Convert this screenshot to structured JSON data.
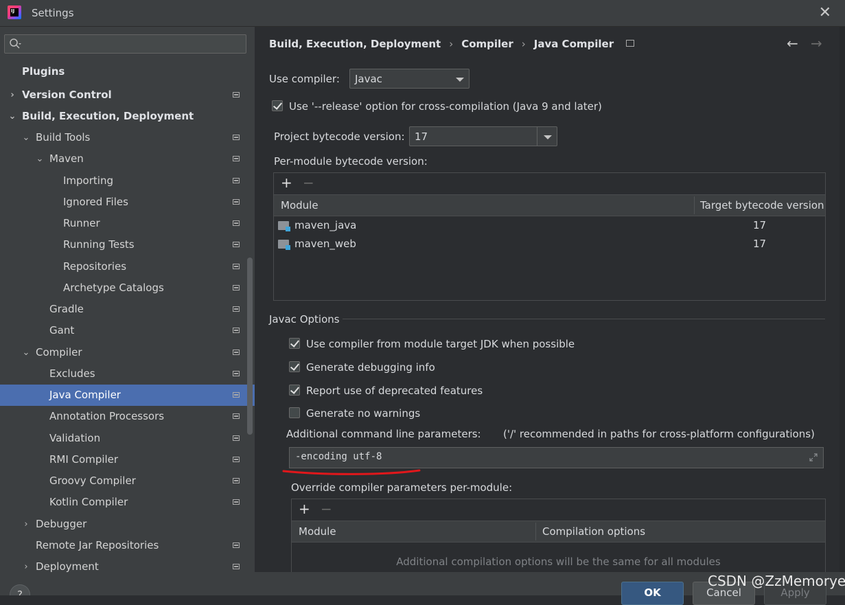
{
  "window": {
    "title": "Settings",
    "close_icon": "close-icon"
  },
  "sidebar": {
    "search_placeholder": "",
    "items": [
      {
        "label": "Plugins"
      },
      {
        "label": "Version Control"
      },
      {
        "label": "Build, Execution, Deployment"
      },
      {
        "label": "Build Tools"
      },
      {
        "label": "Maven"
      },
      {
        "label": "Importing"
      },
      {
        "label": "Ignored Files"
      },
      {
        "label": "Runner"
      },
      {
        "label": "Running Tests"
      },
      {
        "label": "Repositories"
      },
      {
        "label": "Archetype Catalogs"
      },
      {
        "label": "Gradle"
      },
      {
        "label": "Gant"
      },
      {
        "label": "Compiler"
      },
      {
        "label": "Excludes"
      },
      {
        "label": "Java Compiler"
      },
      {
        "label": "Annotation Processors"
      },
      {
        "label": "Validation"
      },
      {
        "label": "RMI Compiler"
      },
      {
        "label": "Groovy Compiler"
      },
      {
        "label": "Kotlin Compiler"
      },
      {
        "label": "Debugger"
      },
      {
        "label": "Remote Jar Repositories"
      },
      {
        "label": "Deployment"
      }
    ],
    "help_label": "?"
  },
  "breadcrumb": {
    "items": [
      "Build, Execution, Deployment",
      "Compiler",
      "Java Compiler"
    ],
    "separator": "›"
  },
  "nav": {
    "back": "←",
    "forward": "→"
  },
  "compiler": {
    "use_compiler_label": "Use compiler:",
    "use_compiler_value": "Javac",
    "release_option_label": "Use '--release' option for cross-compilation (Java 9 and later)",
    "project_bytecode_label": "Project bytecode version:",
    "project_bytecode_value": "17",
    "per_module_label": "Per-module bytecode version:"
  },
  "module_table": {
    "add": "+",
    "remove": "−",
    "columns": [
      "Module",
      "Target bytecode version"
    ],
    "rows": [
      {
        "module": "maven_java",
        "version": "17"
      },
      {
        "module": "maven_web",
        "version": "17"
      }
    ]
  },
  "javac_options": {
    "title": "Javac Options",
    "checkboxes": [
      {
        "label": "Use compiler from module target JDK when possible",
        "checked": true
      },
      {
        "label": "Generate debugging info",
        "checked": true
      },
      {
        "label": "Report use of deprecated features",
        "checked": true
      },
      {
        "label": "Generate no warnings",
        "checked": false
      }
    ],
    "additional_params_label": "Additional command line parameters:",
    "additional_params_hint": "('/' recommended in paths for cross-platform configurations)",
    "additional_params_value": "-encoding utf-8",
    "override_label": "Override compiler parameters per-module:"
  },
  "override_table": {
    "add": "+",
    "remove": "−",
    "columns": [
      "Module",
      "Compilation options"
    ],
    "empty_text": "Additional compilation options will be the same for all modules"
  },
  "buttons": {
    "ok": "OK",
    "cancel": "Cancel",
    "apply": "Apply"
  },
  "watermark": "CSDN @ZzMemorye",
  "colors": {
    "selection": "#4b6eaf",
    "annotation_red": "#e0171b",
    "ok_button": "#365880"
  }
}
